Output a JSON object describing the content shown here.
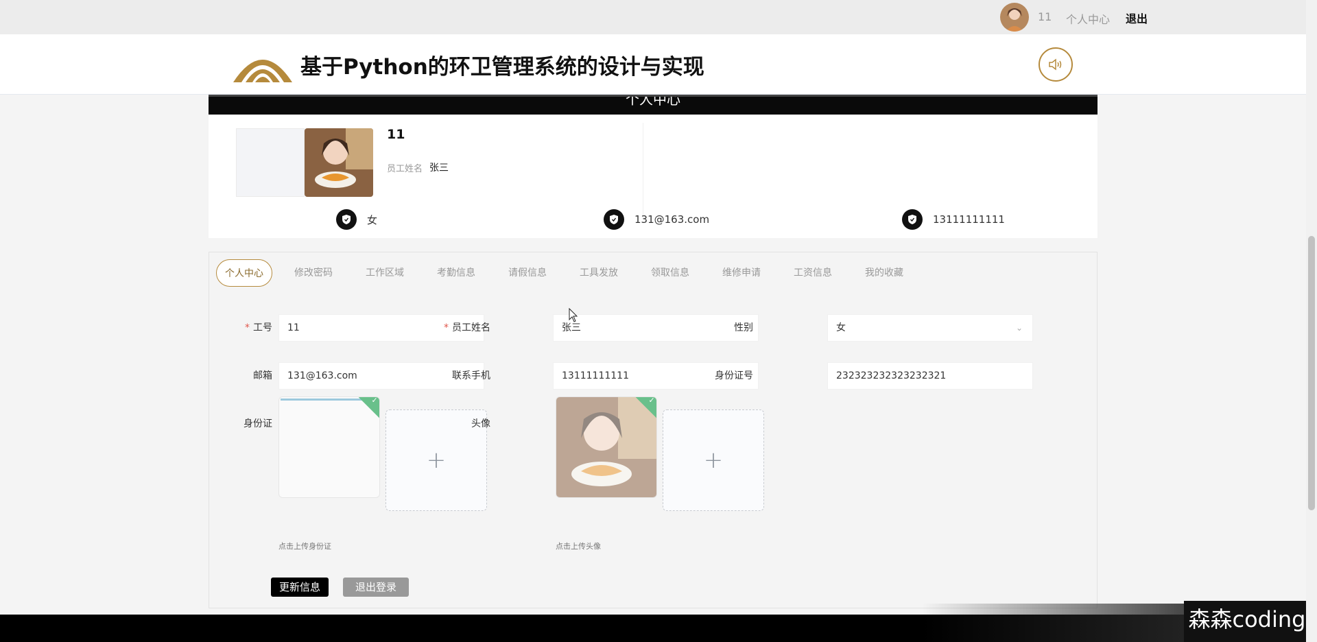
{
  "topbar": {
    "username": "11",
    "center_link": "个人中心",
    "logout_link": "退出"
  },
  "header": {
    "title": "基于Python的环卫管理系统的设计与实现"
  },
  "section_banner": "个人中心",
  "profile": {
    "id": "11",
    "name_label": "员工姓名",
    "name_value": "张三",
    "gender": "女",
    "email": "131@163.com",
    "phone": "13111111111"
  },
  "tabs": [
    {
      "label": "个人中心",
      "active": true
    },
    {
      "label": "修改密码",
      "active": false
    },
    {
      "label": "工作区域",
      "active": false
    },
    {
      "label": "考勤信息",
      "active": false
    },
    {
      "label": "请假信息",
      "active": false
    },
    {
      "label": "工具发放",
      "active": false
    },
    {
      "label": "领取信息",
      "active": false
    },
    {
      "label": "维修申请",
      "active": false
    },
    {
      "label": "工资信息",
      "active": false
    },
    {
      "label": "我的收藏",
      "active": false
    }
  ],
  "form": {
    "gonghao_label": "工号",
    "gonghao_value": "11",
    "name_label": "员工姓名",
    "name_value": "张三",
    "gender_label": "性别",
    "gender_value": "女",
    "email_label": "邮箱",
    "email_value": "131@163.com",
    "phone_label": "联系手机",
    "phone_value": "13111111111",
    "idno_label": "身份证号",
    "idno_value": "232323232323232321",
    "idcard_label": "身份证",
    "avatar_label": "头像",
    "idcard_hint": "点击上传身份证",
    "avatar_hint": "点击上传头像",
    "add_symbol": "+",
    "update_button": "更新信息",
    "logout_button": "退出登录"
  },
  "watermark": "森森coding",
  "colors": {
    "accent_gold": "#b58a3c",
    "required_red": "#e0574c",
    "success_green": "#69c08b"
  }
}
